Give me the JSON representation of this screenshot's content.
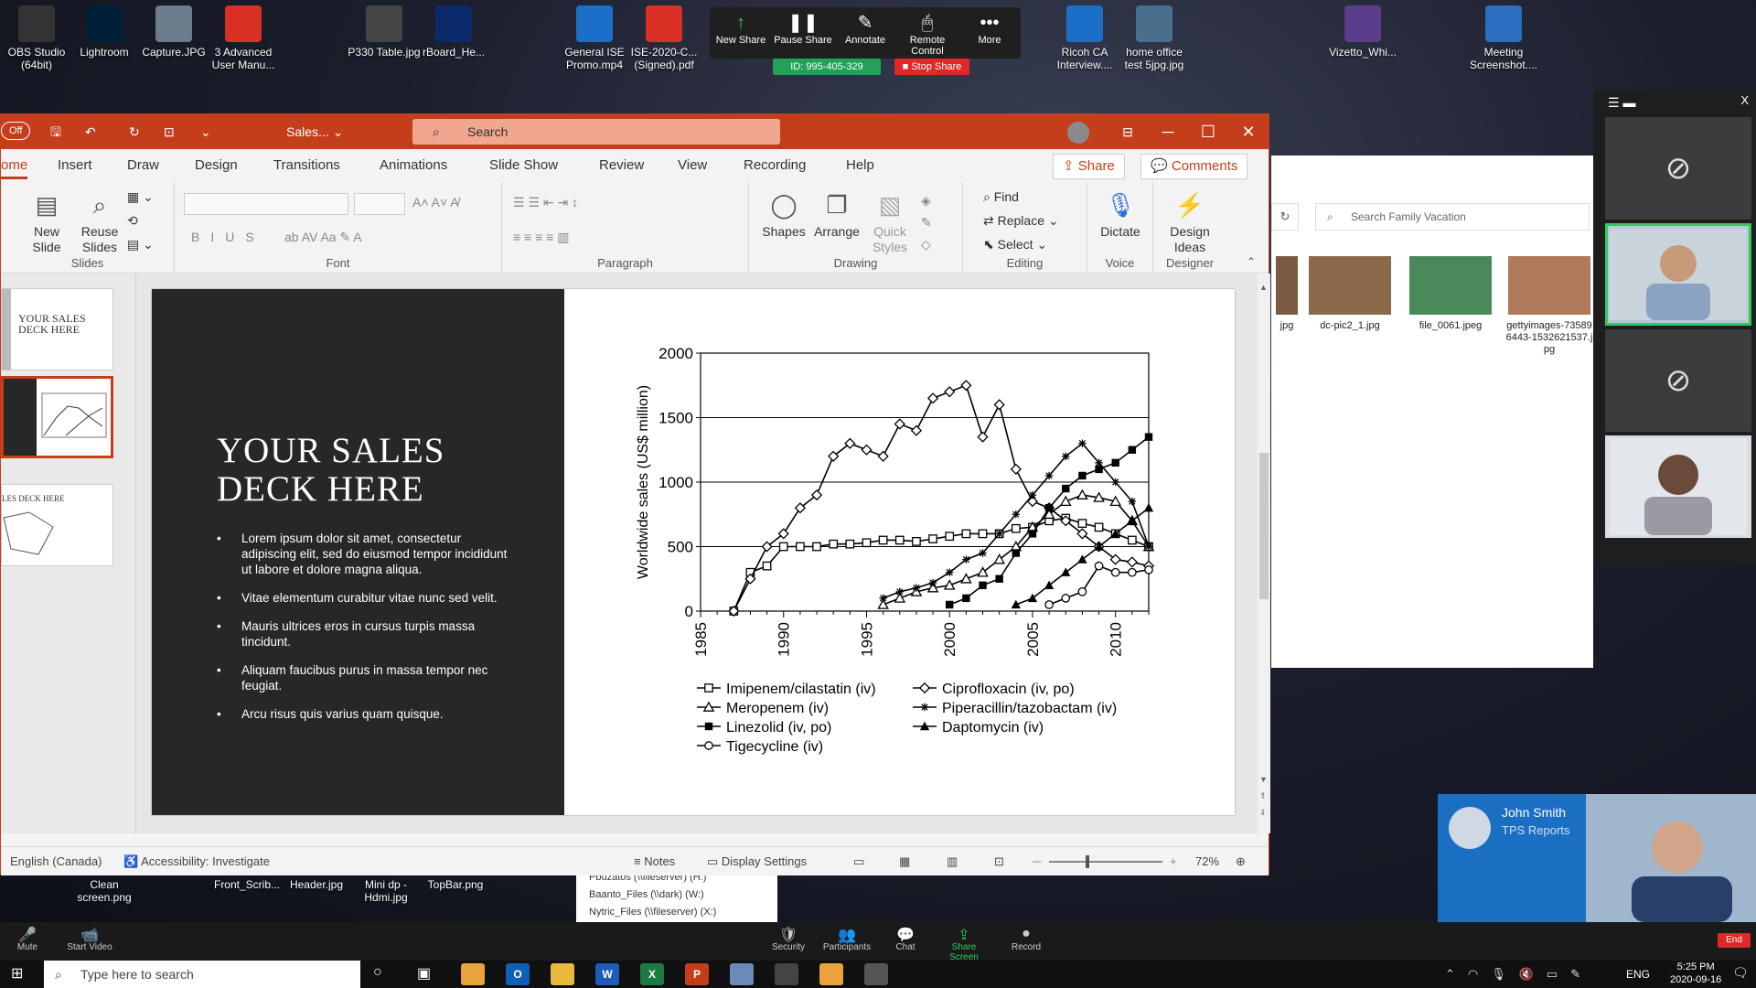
{
  "desktop_icons": [
    {
      "label": "OBS Studio (64bit)",
      "color": "#333"
    },
    {
      "label": "Lightroom",
      "color": "#001e36"
    },
    {
      "label": "Capture.JPG",
      "color": "#6d7c8c"
    },
    {
      "label": "3 Advanced User Manu...",
      "color": "#d93025"
    },
    {
      "label": "P330 Table.jpg",
      "color": "#444"
    },
    {
      "label": "rBoard_He...",
      "color": "#0b2a6b"
    },
    {
      "label": "General ISE Promo.mp4",
      "color": "#1b6fc7"
    },
    {
      "label": "ISE-2020-C... (Signed).pdf",
      "color": "#d93025"
    },
    {
      "label": "Ricoh CA Interview....",
      "color": "#1b6fc7"
    },
    {
      "label": "home office test 5jpg.jpg",
      "color": "#4a6f8c"
    },
    {
      "label": "Vizetto_Whi...",
      "color": "#5a3e8c"
    },
    {
      "label": "Meeting Screenshot....",
      "color": "#2a6fc0"
    }
  ],
  "zoom_toolbar": {
    "buttons": [
      {
        "label": "New Share",
        "icon": "↑"
      },
      {
        "label": "Pause Share",
        "icon": "❚❚"
      },
      {
        "label": "Annotate",
        "icon": "✎"
      },
      {
        "label": "Remote Control",
        "icon": "🖱"
      },
      {
        "label": "More",
        "icon": "•••"
      }
    ],
    "meeting_id": "ID: 995-405-329",
    "stop_share": "Stop Share"
  },
  "ppt": {
    "autosave": "Off",
    "filename": "Sales...",
    "search_placeholder": "Search",
    "tabs": [
      "ome",
      "Insert",
      "Draw",
      "Design",
      "Transitions",
      "Animations",
      "Slide Show",
      "Review",
      "View",
      "Recording",
      "Help"
    ],
    "share": "Share",
    "comments": "Comments",
    "ribbon": {
      "slides_group": "Slides",
      "new_slide": "New Slide",
      "reuse_slides": "Reuse Slides",
      "font_group": "Font",
      "paragraph_group": "Paragraph",
      "drawing_group": "Drawing",
      "shapes": "Shapes",
      "arrange": "Arrange",
      "quick_styles": "Quick Styles",
      "editing_group": "Editing",
      "find": "Find",
      "replace": "Replace",
      "select": "Select",
      "voice_group": "Voice",
      "dictate": "Dictate",
      "designer_group": "Designer",
      "design_ideas": "Design Ideas"
    },
    "thumbs": [
      {
        "title": "YOUR SALES DECK HERE"
      },
      {
        "title": ""
      },
      {
        "title": "LES DECK HERE"
      }
    ],
    "slide": {
      "title": "YOUR SALES DECK HERE",
      "bullets": [
        "Lorem ipsum dolor sit amet, consectetur adipiscing elit, sed do eiusmod tempor incididunt ut labore et dolore magna aliqua.",
        "Vitae elementum curabitur vitae nunc sed velit.",
        "Mauris ultrices eros in cursus turpis massa tincidunt.",
        "Aliquam faucibus purus in massa tempor nec feugiat.",
        "Arcu risus quis varius quam quisque."
      ]
    },
    "status": {
      "language": "English (Canada)",
      "accessibility": "Accessibility: Investigate",
      "notes": "Notes",
      "display_settings": "Display Settings",
      "zoom": "72%"
    }
  },
  "chart_data": {
    "type": "line",
    "title": "",
    "xlabel": "",
    "ylabel": "Worldwide sales (US$ million)",
    "xlim": [
      1985,
      2012
    ],
    "ylim": [
      0,
      2000
    ],
    "xticks": [
      1985,
      1990,
      1995,
      2000,
      2005,
      2010
    ],
    "yticks": [
      0,
      500,
      1000,
      1500,
      2000
    ],
    "grid": "horizontal",
    "legend_position": "bottom",
    "series": [
      {
        "name": "Imipenem/cilastatin (iv)",
        "marker": "square-open",
        "x": [
          1987,
          1988,
          1989,
          1990,
          1991,
          1992,
          1993,
          1994,
          1995,
          1996,
          1997,
          1998,
          1999,
          2000,
          2001,
          2002,
          2003,
          2004,
          2005,
          2006,
          2007,
          2008,
          2009,
          2010,
          2011,
          2012
        ],
        "y": [
          0,
          300,
          350,
          500,
          500,
          500,
          520,
          520,
          530,
          550,
          550,
          540,
          560,
          580,
          600,
          600,
          600,
          640,
          650,
          700,
          720,
          680,
          650,
          600,
          550,
          500
        ]
      },
      {
        "name": "Ciprofloxacin (iv, po)",
        "marker": "diamond-open",
        "x": [
          1987,
          1988,
          1989,
          1990,
          1991,
          1992,
          1993,
          1994,
          1995,
          1996,
          1997,
          1998,
          1999,
          2000,
          2001,
          2002,
          2003,
          2004,
          2005,
          2006,
          2007,
          2008,
          2009,
          2010,
          2011,
          2012
        ],
        "y": [
          0,
          250,
          500,
          600,
          800,
          900,
          1200,
          1300,
          1250,
          1200,
          1450,
          1400,
          1650,
          1700,
          1750,
          1350,
          1600,
          1100,
          850,
          800,
          700,
          600,
          500,
          400,
          380,
          350
        ]
      },
      {
        "name": "Meropenem (iv)",
        "marker": "triangle-open",
        "x": [
          1996,
          1997,
          1998,
          1999,
          2000,
          2001,
          2002,
          2003,
          2004,
          2005,
          2006,
          2007,
          2008,
          2009,
          2010,
          2011,
          2012
        ],
        "y": [
          50,
          100,
          150,
          180,
          200,
          250,
          300,
          400,
          500,
          650,
          750,
          850,
          900,
          880,
          850,
          700,
          500
        ]
      },
      {
        "name": "Piperacillin/tazobactam (iv)",
        "marker": "star",
        "x": [
          1996,
          1997,
          1998,
          1999,
          2000,
          2001,
          2002,
          2003,
          2004,
          2005,
          2006,
          2007,
          2008,
          2009,
          2010,
          2011,
          2012
        ],
        "y": [
          100,
          150,
          180,
          220,
          300,
          400,
          450,
          600,
          750,
          900,
          1050,
          1200,
          1300,
          1150,
          1000,
          850,
          500
        ]
      },
      {
        "name": "Linezolid (iv, po)",
        "marker": "square-filled",
        "x": [
          2000,
          2001,
          2002,
          2003,
          2004,
          2005,
          2006,
          2007,
          2008,
          2009,
          2010,
          2011,
          2012
        ],
        "y": [
          50,
          100,
          200,
          250,
          450,
          600,
          800,
          950,
          1050,
          1100,
          1150,
          1250,
          1350
        ]
      },
      {
        "name": "Daptomycin (iv)",
        "marker": "triangle-filled",
        "x": [
          2004,
          2005,
          2006,
          2007,
          2008,
          2009,
          2010,
          2011,
          2012
        ],
        "y": [
          50,
          100,
          200,
          300,
          400,
          500,
          600,
          700,
          800
        ]
      },
      {
        "name": "Tigecycline (iv)",
        "marker": "circle-open",
        "x": [
          2006,
          2007,
          2008,
          2009,
          2010,
          2011,
          2012
        ],
        "y": [
          50,
          100,
          150,
          350,
          300,
          300,
          320
        ]
      }
    ]
  },
  "explorer": {
    "search_placeholder": "Search Family Vacation",
    "files": [
      {
        "name": "jpg",
        "color": "#7a5a40"
      },
      {
        "name": "dc-pic2_1.jpg",
        "color": "#8a6a4a"
      },
      {
        "name": "file_0061.jpeg",
        "color": "#4a8a5a"
      },
      {
        "name": "gettyimages-735896443-1532621537.jpg",
        "color": "#b07a5a"
      }
    ],
    "tree": [
      "Pbuzatos (\\\\fileserver) (H:)",
      "Baanto_Files (\\\\dark) (W:)",
      "Nytric_Files (\\\\fileserver) (X:)"
    ]
  },
  "desktop_files2": [
    {
      "label": "Clean screen.png"
    },
    {
      "label": "Front_Scrib..."
    },
    {
      "label": "Header.jpg"
    },
    {
      "label": "Mini dp - Hdmi.jpg"
    },
    {
      "label": "TopBar.png"
    }
  ],
  "zoom_panel": {
    "close": "X"
  },
  "speaker": {
    "name": "John Smith",
    "subtitle": "TPS Reports"
  },
  "zoom_controls": [
    {
      "label": "Mute",
      "icon": "🎤"
    },
    {
      "label": "Start Video",
      "icon": "📹"
    },
    {
      "label": "Security",
      "icon": "🛡"
    },
    {
      "label": "Participants",
      "icon": "👥"
    },
    {
      "label": "Chat",
      "icon": "💬"
    },
    {
      "label": "Share Screen",
      "icon": "⇪"
    },
    {
      "label": "Record",
      "icon": "●"
    }
  ],
  "zoom_end": "End",
  "taskbar": {
    "search_placeholder": "Type here to search",
    "apps": [
      {
        "label": "",
        "color": "#e8a33d"
      },
      {
        "label": "O",
        "color": "#0f5fb8"
      },
      {
        "label": "",
        "color": "#e8b93d"
      },
      {
        "label": "W",
        "color": "#1d5cb8"
      },
      {
        "label": "X",
        "color": "#1d7a43"
      },
      {
        "label": "P",
        "color": "#c43e1c"
      },
      {
        "label": "",
        "color": "#6b8ab8"
      },
      {
        "label": "",
        "color": "#444"
      },
      {
        "label": "",
        "color": "#e8a33d"
      },
      {
        "label": "",
        "color": "#555"
      }
    ],
    "lang": "ENG",
    "time": "5:25 PM",
    "date": "2020-09-16"
  }
}
